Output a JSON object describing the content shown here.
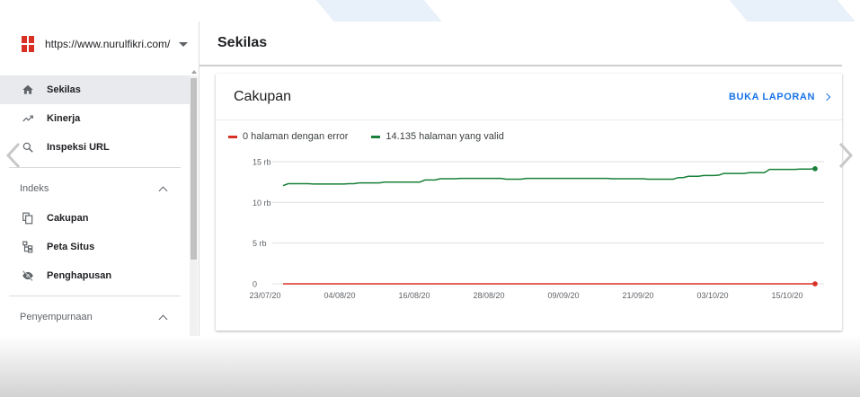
{
  "property": {
    "url": "https://www.nurulfikri.com/"
  },
  "nav": {
    "items": [
      {
        "label": "Sekilas",
        "icon": "home-icon",
        "active": true
      },
      {
        "label": "Kinerja",
        "icon": "trending-up-icon"
      },
      {
        "label": "Inspeksi URL",
        "icon": "search-icon"
      }
    ],
    "sections": [
      {
        "label": "Indeks",
        "items": [
          {
            "label": "Cakupan",
            "icon": "copy-icon"
          },
          {
            "label": "Peta Situs",
            "icon": "sitemap-icon"
          },
          {
            "label": "Penghapusan",
            "icon": "eye-off-icon"
          }
        ]
      },
      {
        "label": "Penyempurnaan",
        "items": []
      }
    ]
  },
  "header": {
    "title": "Sekilas"
  },
  "card": {
    "title": "Cakupan",
    "link_label": "BUKA LAPORAN"
  },
  "colors": {
    "error": "#d93025",
    "valid": "#188038",
    "accent": "#1a73e8"
  },
  "chart_data": {
    "type": "line",
    "x": [
      "23/07/20",
      "04/08/20",
      "16/08/20",
      "28/08/20",
      "09/09/20",
      "21/09/20",
      "03/10/20",
      "15/10/20"
    ],
    "ylim": [
      0,
      15000
    ],
    "ytick_labels": [
      "0",
      "5 rb",
      "10 rb",
      "15 rb"
    ],
    "ytick_values": [
      0,
      5000,
      10000,
      15000
    ],
    "grid": true,
    "legend_position": "top-left",
    "series": [
      {
        "name": "0 halaman dengan error",
        "color": "#d93025",
        "values": [
          0,
          0,
          0,
          0,
          0,
          0,
          0,
          0,
          0,
          0,
          0,
          0,
          0,
          0,
          0,
          0,
          0,
          0,
          0,
          0,
          0,
          0,
          0,
          0,
          0,
          0,
          0,
          0,
          0,
          0,
          0,
          0,
          0,
          0,
          0,
          0,
          0,
          0,
          0,
          0,
          0,
          0,
          0,
          0,
          0,
          0,
          0,
          0,
          0,
          0,
          0,
          0,
          0,
          0,
          0,
          0,
          0,
          0,
          0,
          0,
          0,
          0,
          0,
          0,
          0,
          0,
          0,
          0,
          0,
          0,
          0,
          0,
          0,
          0,
          0,
          0,
          0,
          0,
          0,
          0,
          0,
          0,
          0,
          0,
          0,
          0,
          0,
          0,
          0,
          0,
          0,
          0,
          0
        ]
      },
      {
        "name": "14.135 halaman yang valid",
        "color": "#188038",
        "values": [
          12050,
          12300,
          12300,
          12300,
          12300,
          12300,
          12250,
          12250,
          12250,
          12250,
          12250,
          12250,
          12250,
          12300,
          12300,
          12400,
          12400,
          12400,
          12400,
          12400,
          12500,
          12500,
          12500,
          12500,
          12500,
          12500,
          12500,
          12500,
          12750,
          12750,
          12750,
          12900,
          12900,
          12900,
          12900,
          12950,
          12950,
          12950,
          12950,
          12950,
          12950,
          12950,
          12950,
          12950,
          12850,
          12850,
          12850,
          12850,
          12950,
          12950,
          12950,
          12950,
          12950,
          12950,
          12950,
          12950,
          12950,
          12950,
          12950,
          12950,
          12950,
          12950,
          12950,
          12950,
          12950,
          12900,
          12900,
          12900,
          12900,
          12900,
          12900,
          12900,
          12850,
          12850,
          12850,
          12850,
          12850,
          12850,
          13050,
          13050,
          13200,
          13200,
          13200,
          13300,
          13300,
          13300,
          13350,
          13550,
          13550,
          13550,
          13550,
          13550,
          13650,
          13650,
          13650,
          13650,
          14050,
          14050,
          14050,
          14050,
          14050,
          14050,
          14100,
          14100,
          14100,
          14135
        ]
      }
    ]
  }
}
